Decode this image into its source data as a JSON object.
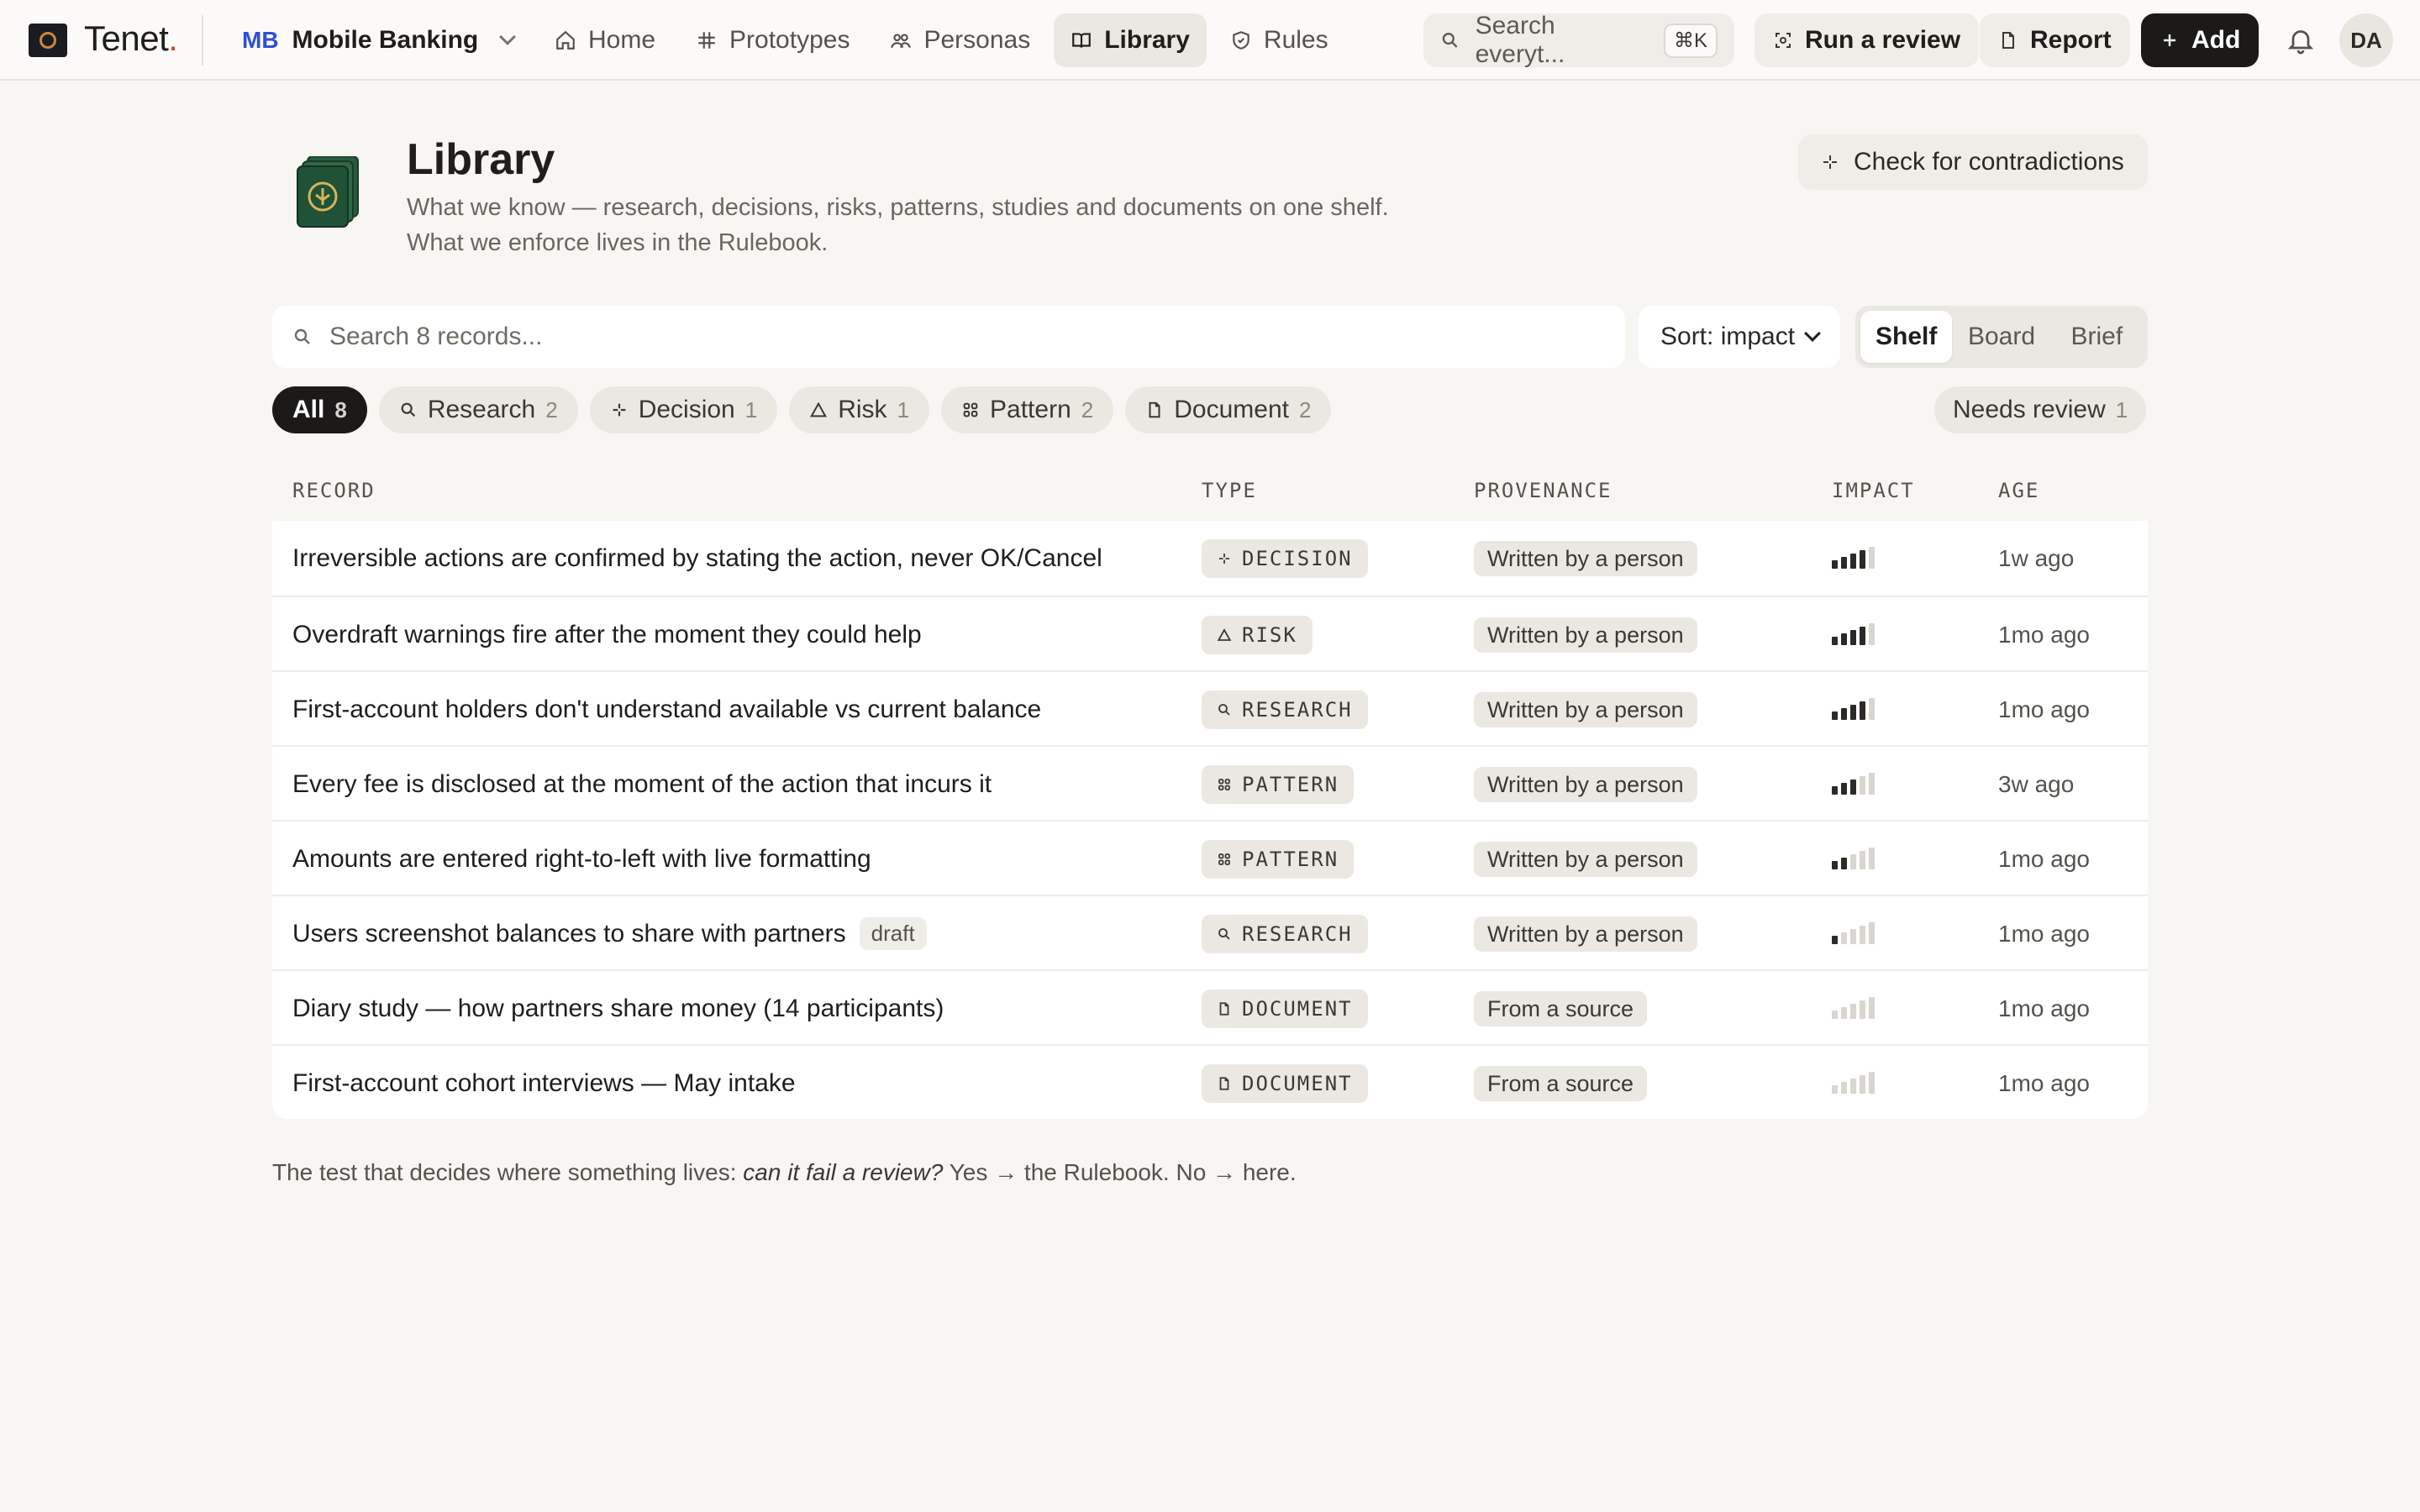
{
  "app": {
    "brand": "Tenet",
    "brand_dot": ".",
    "workspace_initials": "MB",
    "workspace_name": "Mobile Banking"
  },
  "nav": {
    "tabs": [
      {
        "label": "Home",
        "icon": "home-icon",
        "active": false
      },
      {
        "label": "Prototypes",
        "icon": "hash-icon",
        "active": false
      },
      {
        "label": "Personas",
        "icon": "personas-icon",
        "active": false
      },
      {
        "label": "Library",
        "icon": "book-icon",
        "active": true
      },
      {
        "label": "Rules",
        "icon": "shield-icon",
        "active": false
      }
    ],
    "search_placeholder": "Search everyt...",
    "search_shortcut": "⌘K",
    "run_review": "Run a review",
    "report": "Report",
    "add": "Add",
    "avatar": "DA"
  },
  "header": {
    "title": "Library",
    "subtitle_1": "What we know — research, decisions, risks, patterns, studies and documents on one shelf.",
    "subtitle_2": "What we enforce lives in the Rulebook.",
    "contradictions_button": "Check for contradictions"
  },
  "controls": {
    "search_placeholder": "Search 8 records...",
    "sort_label": "Sort: impact",
    "views": [
      {
        "label": "Shelf",
        "active": true
      },
      {
        "label": "Board",
        "active": false
      },
      {
        "label": "Brief",
        "active": false
      }
    ]
  },
  "filters": {
    "chips": [
      {
        "label": "All",
        "count": "8",
        "icon": "",
        "active": true
      },
      {
        "label": "Research",
        "count": "2",
        "icon": "search-icon",
        "active": false
      },
      {
        "label": "Decision",
        "count": "1",
        "icon": "sparkle-icon",
        "active": false
      },
      {
        "label": "Risk",
        "count": "1",
        "icon": "warning-icon",
        "active": false
      },
      {
        "label": "Pattern",
        "count": "2",
        "icon": "grid-icon",
        "active": false
      },
      {
        "label": "Document",
        "count": "2",
        "icon": "document-icon",
        "active": false
      }
    ],
    "needs_review": {
      "label": "Needs review",
      "count": "1"
    }
  },
  "table": {
    "columns": [
      "RECORD",
      "TYPE",
      "PROVENANCE",
      "IMPACT",
      "AGE"
    ],
    "rows": [
      {
        "record": "Irreversible actions are confirmed by stating the action, never OK/Cancel",
        "draft": "",
        "type": "DECISION",
        "type_icon": "sparkle-icon",
        "provenance": "Written by a person",
        "impact_level": 4,
        "age": "1w ago"
      },
      {
        "record": "Overdraft warnings fire after the moment they could help",
        "draft": "",
        "type": "RISK",
        "type_icon": "warning-icon",
        "provenance": "Written by a person",
        "impact_level": 4,
        "age": "1mo ago"
      },
      {
        "record": "First-account holders don't understand available vs current balance",
        "draft": "",
        "type": "RESEARCH",
        "type_icon": "search-icon",
        "provenance": "Written by a person",
        "impact_level": 4,
        "age": "1mo ago"
      },
      {
        "record": "Every fee is disclosed at the moment of the action that incurs it",
        "draft": "",
        "type": "PATTERN",
        "type_icon": "grid-icon",
        "provenance": "Written by a person",
        "impact_level": 3,
        "age": "3w ago"
      },
      {
        "record": "Amounts are entered right-to-left with live formatting",
        "draft": "",
        "type": "PATTERN",
        "type_icon": "grid-icon",
        "provenance": "Written by a person",
        "impact_level": 2,
        "age": "1mo ago"
      },
      {
        "record": "Users screenshot balances to share with partners",
        "draft": "draft",
        "type": "RESEARCH",
        "type_icon": "search-icon",
        "provenance": "Written by a person",
        "impact_level": 1,
        "age": "1mo ago"
      },
      {
        "record": "Diary study — how partners share money (14 participants)",
        "draft": "",
        "type": "DOCUMENT",
        "type_icon": "document-icon",
        "provenance": "From a source",
        "impact_level": 0,
        "age": "1mo ago"
      },
      {
        "record": "First-account cohort interviews — May intake",
        "draft": "",
        "type": "DOCUMENT",
        "type_icon": "document-icon",
        "provenance": "From a source",
        "impact_level": 0,
        "age": "1mo ago"
      }
    ]
  },
  "footnote": {
    "prefix": "The test that decides where something lives:",
    "question": "can it fail a review?",
    "suffix": "Yes → the Rulebook. No → here."
  }
}
